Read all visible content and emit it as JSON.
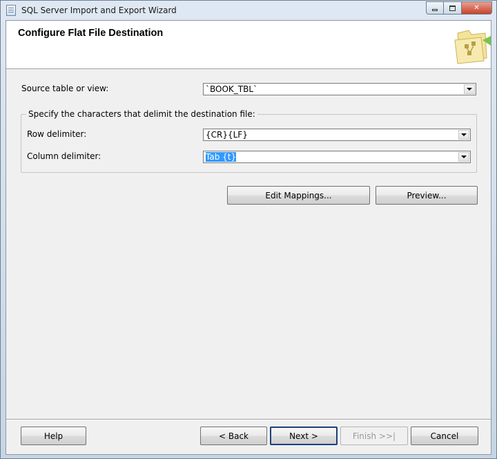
{
  "window": {
    "title": "SQL Server Import and Export Wizard",
    "close_glyph": "✕"
  },
  "header": {
    "title": "Configure Flat File Destination"
  },
  "source": {
    "label": "Source table or view:",
    "value": "`BOOK_TBL`"
  },
  "delimiters": {
    "group_label": "Specify the characters that delimit the destination file:",
    "row_label": "Row delimiter:",
    "row_value": "{CR}{LF}",
    "column_label": "Column delimiter:",
    "column_value": "Tab {t}"
  },
  "actions": {
    "edit_mappings": "Edit Mappings...",
    "preview": "Preview..."
  },
  "footer": {
    "help": "Help",
    "back": "< Back",
    "next": "Next >",
    "finish": "Finish >>|",
    "cancel": "Cancel"
  }
}
